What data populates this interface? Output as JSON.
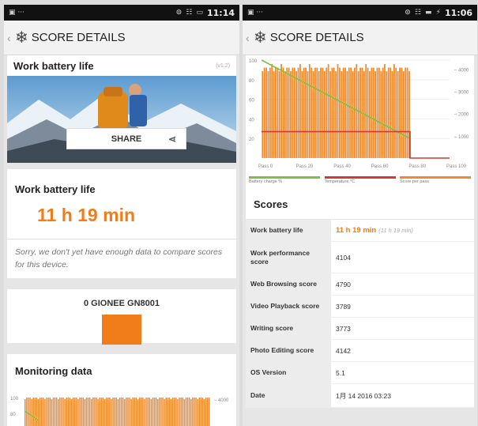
{
  "left": {
    "status": {
      "time": "11:14",
      "icons": "⊙ ☷ ▭"
    },
    "appbar": {
      "title": "SCORE DETAILS"
    },
    "header": {
      "title": "Work battery life",
      "version": "(v1.2)"
    },
    "share_label": "SHARE",
    "result": {
      "title": "Work battery life",
      "value": "11 h 19 min",
      "note": "Sorry, we don't yet have enough data to compare scores for this device."
    },
    "device": {
      "name": "0 GIONEE GN8001"
    },
    "monitoring": {
      "title": "Monitoring data",
      "y_ticks": [
        "100",
        "80"
      ],
      "r_tick": "4000"
    }
  },
  "right": {
    "status": {
      "time": "11:06",
      "icons": "⊙ ☷ ▬ ⚡"
    },
    "appbar": {
      "title": "SCORE DETAILS"
    },
    "chart_data": {
      "type": "line",
      "x_ticks": [
        "Pass 0",
        "Pass 20",
        "Pass 40",
        "Pass 60",
        "Pass 80",
        "Pass 100"
      ],
      "y_ticks_left": [
        "100",
        "80",
        "60",
        "40",
        "20"
      ],
      "y_ticks_right": [
        "4000",
        "3000",
        "2000",
        "1000"
      ],
      "series": [
        {
          "name": "Battery charge %",
          "color": "#7cc142",
          "points": [
            [
              0,
              100
            ],
            [
              79,
              20
            ]
          ]
        },
        {
          "name": "Temperature °C",
          "color": "#d23b2f",
          "points": [
            [
              0,
              27
            ],
            [
              79,
              27
            ],
            [
              79,
              0
            ],
            [
              100,
              0
            ]
          ]
        },
        {
          "name": "Score per pass",
          "color": "#f08a2a",
          "bars_until_pass": 100
        }
      ]
    },
    "legend": [
      "Battery charge %",
      "Temperature °C",
      "Score per pass"
    ],
    "scores_title": "Scores",
    "rows": [
      {
        "k": "Work battery life",
        "v": "11 h 19 min",
        "sub": "(11 h 19 min)",
        "highlight": true
      },
      {
        "k": "Work performance score",
        "v": "4104"
      },
      {
        "k": "Web Browsing score",
        "v": "4790"
      },
      {
        "k": "Video Playback score",
        "v": "3789"
      },
      {
        "k": "Writing score",
        "v": "3773"
      },
      {
        "k": "Photo Editing score",
        "v": "4142"
      },
      {
        "k": "OS Version",
        "v": "5.1"
      },
      {
        "k": "Date",
        "v": "1月 14 2016 03:23"
      }
    ]
  }
}
